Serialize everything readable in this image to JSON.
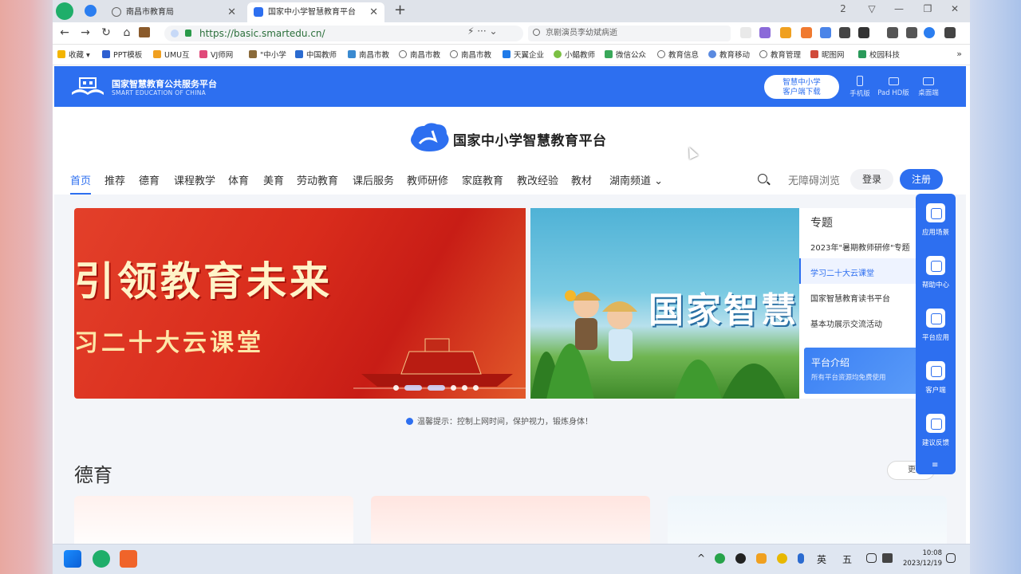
{
  "browser": {
    "tabs": [
      {
        "title": "南昌市教育局",
        "active": false
      },
      {
        "title": "国家中小学智慧教育平台",
        "active": true
      }
    ],
    "new_tab": "+",
    "window_controls": [
      "2",
      "▽",
      "—",
      "❐",
      "✕"
    ],
    "url": "https://basic.smartedu.cn/",
    "url_actions": "⚡ ··· ⌄",
    "search_placeholder": "京剧演员李幼斌病逝",
    "bookmarks": [
      "收藏",
      "PPT模板",
      "UMU互",
      "VJ师网",
      "\"中小学",
      "中国教师",
      "南昌市教",
      "南昌市教",
      "南昌市教",
      "天翼企业",
      "小鲳教师",
      "微信公众",
      "教育信息",
      "教育移动",
      "教育管理",
      "昵图网",
      "校园科技"
    ],
    "bookmarks_more": "»"
  },
  "site_header": {
    "logo_cn": "国家智慧教育公共服务平台",
    "logo_en": "SMART EDUCATION OF CHINA",
    "client_download_line1": "智慧中小学",
    "client_download_line2": "客户端下载",
    "devices": [
      "手机版",
      "Pad HD版",
      "桌面端"
    ]
  },
  "brand": {
    "title": "国家中小学智慧教育平台"
  },
  "nav": {
    "items": [
      "首页",
      "推荐",
      "德育",
      "课程教学",
      "体育",
      "美育",
      "劳动教育",
      "课后服务",
      "教师研修",
      "家庭教育",
      "教改经验",
      "教材",
      "湖南频道 ⌄"
    ],
    "accessibility": "无障碍浏览",
    "login": "登录",
    "register": "注册"
  },
  "banner": {
    "main_text": "引领教育未来",
    "sub_text": "习二十大云课堂",
    "second_text": "国家智慧"
  },
  "topics": {
    "title": "专题",
    "items": [
      "2023年\"暑期教师研修\"专题",
      "学习二十大云课堂",
      "国家智慧教育读书平台",
      "基本功展示交流活动"
    ],
    "selected_index": 1,
    "platform_title": "平台介绍",
    "platform_desc": "所有平台资源均免费使用"
  },
  "tip": "温馨提示：控制上网时间，保护视力，锻炼身体！",
  "section": {
    "title": "德育",
    "more": "更多"
  },
  "sidebar": {
    "items": [
      "应用场景",
      "帮助中心",
      "平台应用",
      "客户端",
      "建议反馈"
    ],
    "menu": "≡"
  },
  "taskbar": {
    "tray": [
      "^",
      "英",
      "五"
    ],
    "time": "10:08",
    "date": "2023/12/19"
  }
}
